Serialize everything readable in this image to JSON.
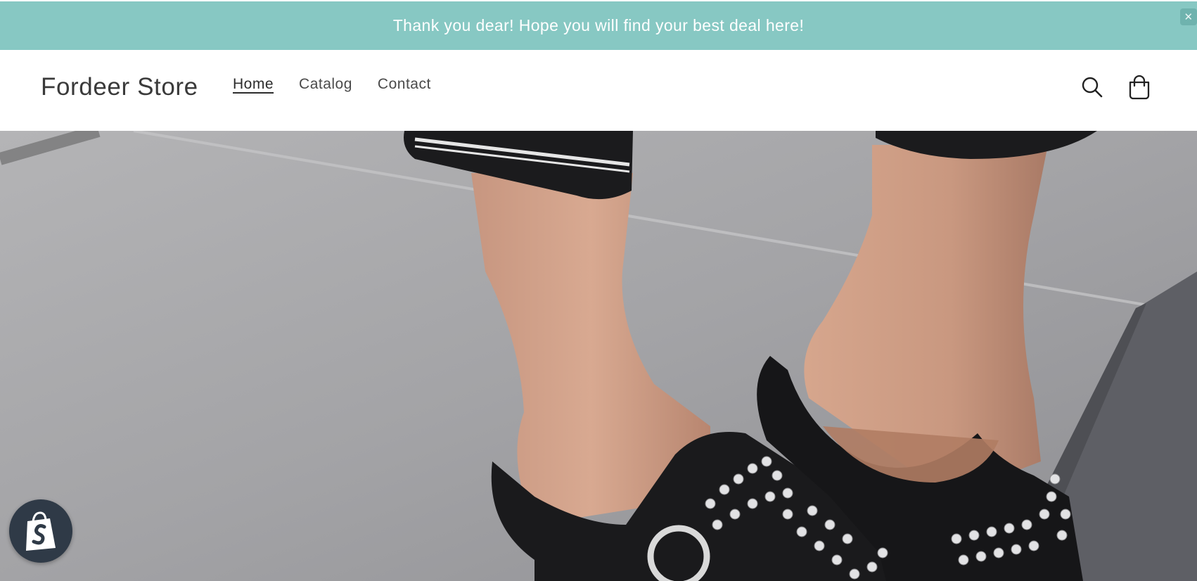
{
  "announcement": {
    "text": "Thank you dear! Hope you will find your best deal here!",
    "close_symbol": "✕"
  },
  "header": {
    "logo": "Fordeer Store",
    "nav": [
      {
        "label": "Home",
        "active": true
      },
      {
        "label": "Catalog",
        "active": false
      },
      {
        "label": "Contact",
        "active": false
      }
    ],
    "icons": {
      "search": "search-icon",
      "cart": "cart-icon"
    }
  },
  "hero": {
    "image": "studded-black-mules-photo"
  },
  "badge": {
    "icon": "shopify-bag-icon"
  },
  "colors": {
    "announcement_bg": "#87c8c3",
    "text_dark": "#3a3a3a",
    "badge_bg": "#2f3a47"
  }
}
